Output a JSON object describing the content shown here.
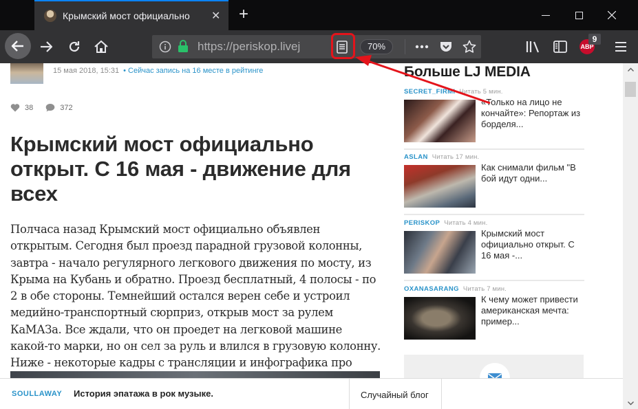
{
  "browser": {
    "tab_title": "Крымский мост официально",
    "url": "https://periskop.livej",
    "zoom": "70%",
    "adblock_label": "ABP",
    "adblock_count": "9",
    "highlight_color": "#e4141b",
    "accent_color": "#0a84ff"
  },
  "post": {
    "meta_date": "15 мая 2018, 15:31",
    "meta_rating": "• Сейчас запись на 16 месте в рейтинге",
    "likes": "38",
    "comments": "372",
    "title": "Крымский мост официально открыт. С 16 мая - движение для всех",
    "body": "Полчаса назад Крымский мост официально объявлен открытым. Сегодня был проезд парадной грузовой колонны, завтра - начало регулярного легкового движения по мосту, из Крыма на Кубань и обратно. Проезд бесплатный, 4 полосы - по 2 в обе стороны. Темнейший остался верен себе и устроил медийно-транспортный сюрприз, открыв мост за рулем КаМАЗа. Все ждали, что он проедет на легковой машине какой-то марки, но он сел за руль и влился в грузовую колонну. Ниже - некоторые кадры с трансляции и инфографика про открытие движения для всех."
  },
  "sidebar": {
    "heading": "Больше LJ MEDIA",
    "items": [
      {
        "user": "SECRET_FIRMI",
        "read": "Читать 5 мин.",
        "text": "«Только на лицо не кончайте»: Репортаж из борделя..."
      },
      {
        "user": "ASLAN",
        "read": "Читать 17 мин.",
        "text": "Как снимали фильм \"В бой идут одни..."
      },
      {
        "user": "PERISKOP",
        "read": "Читать 4 мин.",
        "text": "Крымский мост официально открыт. С 16 мая -..."
      },
      {
        "user": "OXANASARANG",
        "read": "Читать 7 мин.",
        "text": "К чему может привести американская мечта: пример..."
      }
    ]
  },
  "bottom_bar": {
    "user": "SOULLAWAY",
    "title": "История эпатажа в рок музыке.",
    "random_blog": "Случайный блог"
  },
  "icons": {
    "back": "back-arrow-icon",
    "forward": "forward-arrow-icon",
    "reload": "reload-icon",
    "home": "home-icon",
    "info": "info-icon",
    "lock": "lock-icon",
    "reader": "reader-view-icon",
    "more": "more-icon",
    "pocket": "pocket-icon",
    "bookmark": "bookmark-star-icon",
    "library": "library-icon",
    "sidebar": "sidebar-icon",
    "menu": "hamburger-menu-icon",
    "like": "heart-icon",
    "comment": "comment-icon",
    "mail": "mail-icon"
  }
}
